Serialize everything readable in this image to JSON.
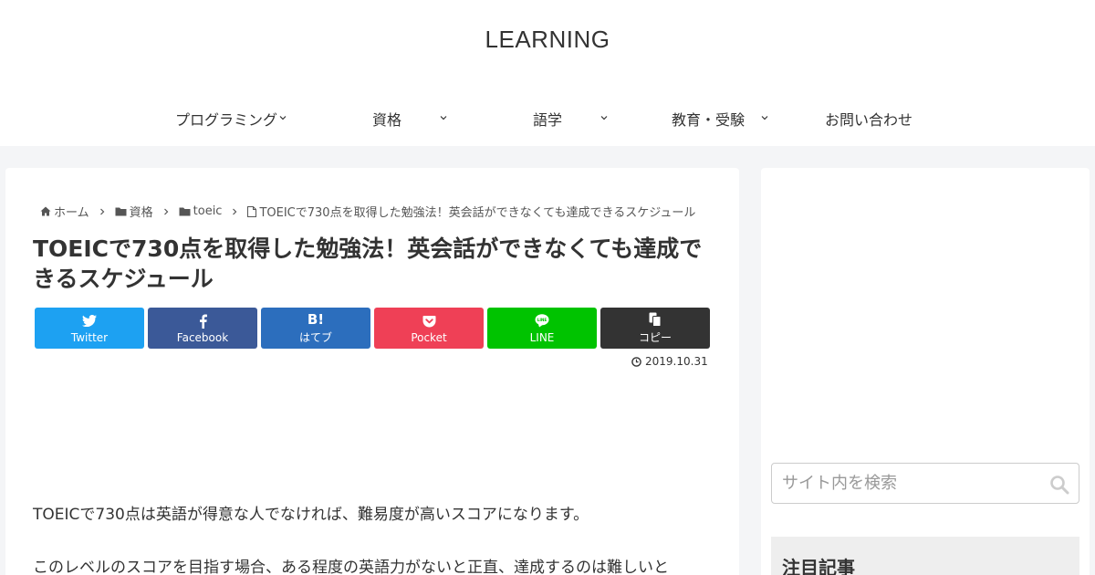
{
  "site": {
    "title": "LEARNING"
  },
  "nav": {
    "items": [
      {
        "label": "プログラミング",
        "has_dropdown": true
      },
      {
        "label": "資格",
        "has_dropdown": true
      },
      {
        "label": "語学",
        "has_dropdown": true
      },
      {
        "label": "教育・受験",
        "has_dropdown": true
      },
      {
        "label": "お問い合わせ",
        "has_dropdown": false
      }
    ]
  },
  "breadcrumb": {
    "items": [
      {
        "label": "ホーム",
        "icon": "home-icon"
      },
      {
        "label": "資格",
        "icon": "folder-icon"
      },
      {
        "label": "toeic",
        "icon": "folder-icon"
      },
      {
        "label": "TOEICで730点を取得した勉強法！英会話ができなくても達成できるスケジュール",
        "icon": "file-icon"
      }
    ]
  },
  "article": {
    "title": "TOEICで730点を取得した勉強法！英会話ができなくても達成できるスケジュール",
    "date": "2019.10.31",
    "paragraphs": [
      "TOEICで730点は英語が得意な人でなければ、難易度が高いスコアになります。",
      "このレベルのスコアを目指す場合、ある程度の英語力がないと正直、達成するのは難しいと"
    ]
  },
  "share": {
    "buttons": [
      {
        "label": "Twitter",
        "icon": "twitter-icon",
        "color": "#1da1f2"
      },
      {
        "label": "Facebook",
        "icon": "facebook-icon",
        "color": "#3b5998"
      },
      {
        "label": "はてブ",
        "icon": "hatena-icon",
        "color": "#2c6ebd"
      },
      {
        "label": "Pocket",
        "icon": "pocket-icon",
        "color": "#ef4056"
      },
      {
        "label": "LINE",
        "icon": "line-icon",
        "color": "#00c300"
      },
      {
        "label": "コピー",
        "icon": "copy-icon",
        "color": "#333333"
      }
    ]
  },
  "sidebar": {
    "search": {
      "placeholder": "サイト内を検索",
      "value": ""
    },
    "widget_title": "注目記事"
  },
  "colors": {
    "page_bg": "#f4f5f7",
    "card_bg": "#ffffff",
    "text": "#333333"
  }
}
